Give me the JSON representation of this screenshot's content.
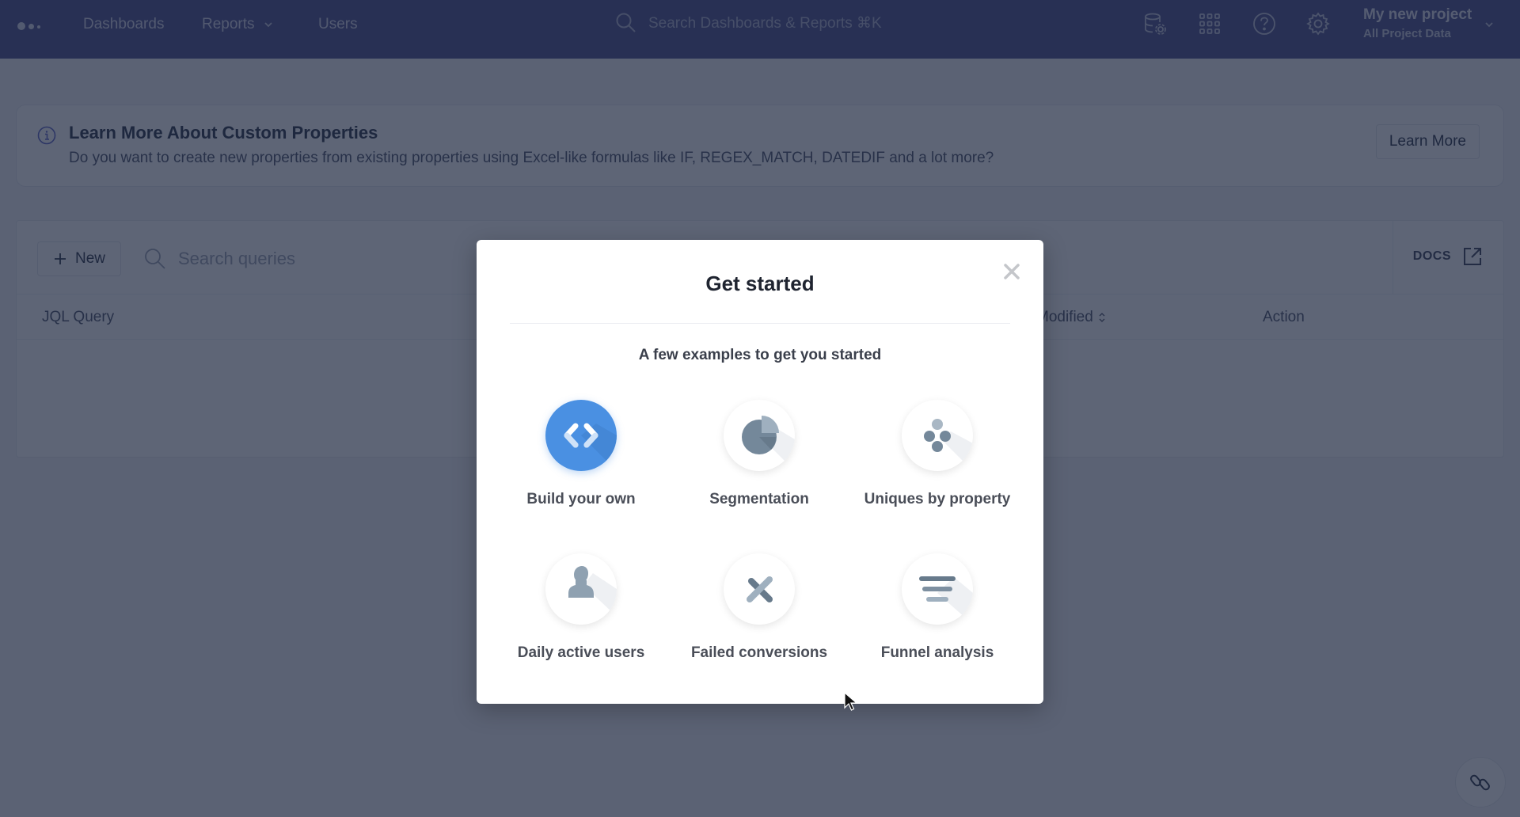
{
  "topnav": {
    "logo": "mixpanel-dots-logo",
    "links": [
      {
        "label": "Dashboards"
      },
      {
        "label": "Reports",
        "has_dropdown": true
      },
      {
        "label": "Users"
      }
    ],
    "search_placeholder": "Search Dashboards & Reports ⌘K",
    "icons": [
      "data-settings-icon",
      "apps-grid-icon",
      "help-icon",
      "settings-gear-icon"
    ],
    "project": {
      "name": "My new project",
      "subtitle": "All Project Data"
    }
  },
  "banner": {
    "title": "Learn More About Custom Properties",
    "description": "Do you want to create new properties from existing properties using Excel-like formulas like IF, REGEX_MATCH, DATEDIF and a lot more?",
    "button_label": "Learn More"
  },
  "queries": {
    "new_button_label": "New",
    "search_placeholder": "Search queries",
    "docs_label": "DOCS",
    "columns": [
      {
        "label": "JQL Query"
      },
      {
        "label": "Modified",
        "sortable": true
      },
      {
        "label": "Action"
      }
    ],
    "rows": []
  },
  "modal": {
    "title": "Get started",
    "subtitle": "A few examples to get you started",
    "examples": [
      {
        "label": "Build your own",
        "icon": "code-brackets-icon",
        "active": true
      },
      {
        "label": "Segmentation",
        "icon": "pie-chart-icon",
        "active": false
      },
      {
        "label": "Uniques by property",
        "icon": "dots-cluster-icon",
        "active": false
      },
      {
        "label": "Daily active users",
        "icon": "user-silhouette-icon",
        "active": false
      },
      {
        "label": "Failed conversions",
        "icon": "x-cross-icon",
        "active": false
      },
      {
        "label": "Funnel analysis",
        "icon": "funnel-icon",
        "active": false
      }
    ]
  },
  "colors": {
    "nav_bg": "#4a4f8c",
    "accent_blue": "#4a90e2",
    "icon_gray": "#7d8fa0",
    "icon_gray_light": "#9fb0bf"
  }
}
